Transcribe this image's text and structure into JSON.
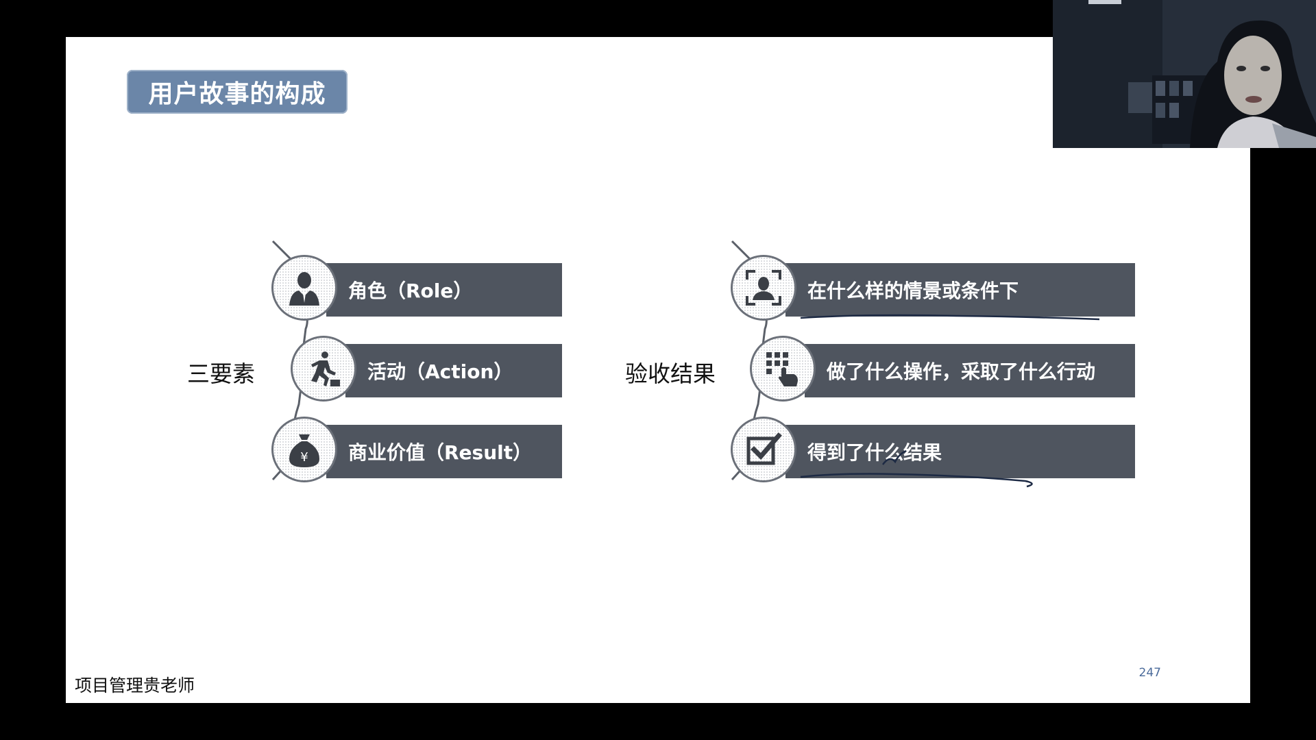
{
  "slide": {
    "title": "用户故事的构成",
    "page_number": "247",
    "footer": "项目管理贵老师"
  },
  "left_group": {
    "label": "三要素",
    "items": [
      {
        "text": "角色（Role）",
        "icon": "person-icon"
      },
      {
        "text": "活动（Action）",
        "icon": "running-person-icon"
      },
      {
        "text": "商业价值（Result）",
        "icon": "money-bag-yuan-icon"
      }
    ]
  },
  "right_group": {
    "label": "验收结果",
    "items": [
      {
        "text": "在什么样的情景或条件下",
        "icon": "scan-person-icon"
      },
      {
        "text": "做了什么操作，采取了什么行动",
        "icon": "keypad-tap-icon"
      },
      {
        "text": "得到了什么结果",
        "icon": "checkbox-checked-icon"
      }
    ]
  },
  "colors": {
    "title_badge": "#6b86a8",
    "bar": "#4f555f",
    "background": "#000000",
    "slide": "#ffffff"
  }
}
